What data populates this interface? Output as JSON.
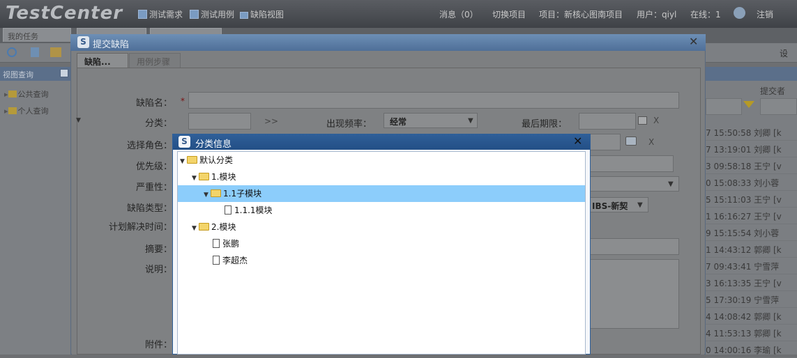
{
  "header": {
    "logo": "TestCenter",
    "nav": [
      "测试需求",
      "测试用例",
      "缺陷视图"
    ],
    "messages": "消息（0）",
    "switch_project": "切换项目",
    "project": "项目：新核心图南项目",
    "user": "用户：qiyl",
    "online": "在线：1",
    "logout": "注销"
  },
  "background": {
    "tabs": [
      "我的任务"
    ],
    "settings": "设",
    "sidebar": {
      "title": "视图查询",
      "items": [
        "公共查询",
        "个人查询"
      ]
    },
    "grid": {
      "header": "提交者",
      "rows": [
        "7 15:50:58  刘卿 [k",
        "7 13:19:01  刘卿 [k",
        "3 09:58:18  王宁 [v",
        "0 15:08:33  刘小蓉",
        "5 15:11:03  王宁 [v",
        "1 16:16:27  王宁 [v",
        "9 15:15:54  刘小蓉",
        "1 14:43:12  郭卿 [k",
        "7 09:43:41  宁雪萍",
        "3 16:13:35  王宁 [v",
        "5 17:30:19  宁雪萍",
        "4 14:08:42  郭卿 [k",
        "4 11:53:13  郭卿 [k",
        "0 14:00:16  李瑜 [k"
      ]
    }
  },
  "defect_dialog": {
    "title": "提交缺陷",
    "tabs": [
      "缺陷...",
      "用例步骤"
    ],
    "fields": {
      "name": "缺陷名：",
      "required": "*",
      "category": "分类：",
      "category_btn": ">>",
      "frequency": "出现频率：",
      "frequency_value": "经常",
      "deadline": "最后期限：",
      "clear": "X",
      "role": "选择角色：",
      "priority": "优先级：",
      "severity": "严重性：",
      "type": "缺陷类型：",
      "type_value": "IBS-新契",
      "plan_time": "计划解决时间：",
      "summary": "摘要：",
      "description": "说明：",
      "attachment": "附件："
    }
  },
  "category_dialog": {
    "title": "分类信息",
    "tree": {
      "root": "默认分类",
      "module1": "1.模块",
      "sub1": "1.1子模块",
      "leaf1": "1.1.1模块",
      "module2": "2.模块",
      "file1": "张鹏",
      "file2": "李超杰"
    }
  }
}
